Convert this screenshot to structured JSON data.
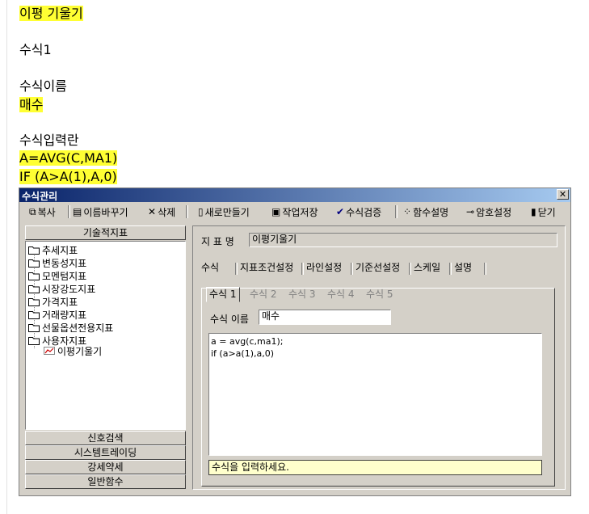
{
  "document": {
    "indicator_name": "이평 기울기",
    "formula_heading": "수식1",
    "formula_name_label": "수식이름",
    "formula_name_value": "매수",
    "formula_input_label": "수식입력란",
    "formula_lines": [
      "A=AVG(C,MA1)",
      "IF (A>A(1),A,0)"
    ]
  },
  "window": {
    "title": "수식관리",
    "close_glyph": "✕",
    "toolbar": {
      "copy": "복사",
      "rename": "이름바꾸기",
      "delete": "삭제",
      "new": "새로만들기",
      "save": "작업저장",
      "verify": "수식검증",
      "func_help": "함수설명",
      "password": "암호설정",
      "close": "닫기"
    },
    "left": {
      "header": "기술적지표",
      "tree": [
        "추세지표",
        "변동성지표",
        "모멘텀지표",
        "시장강도지표",
        "가격지표",
        "거래량지표",
        "선물옵션전용지표",
        "사용자지표"
      ],
      "tree_child": "이평기울기",
      "buttons": [
        "신호검색",
        "시스템트레이딩",
        "강세약세",
        "일반함수"
      ]
    },
    "right": {
      "indicator_label": "지 표 명",
      "indicator_value": "이평기울기",
      "tabs": [
        "수식",
        "지표조건설정",
        "라인설정",
        "기준선설정",
        "스케일",
        "설명"
      ],
      "formula_tabs": [
        "수식 1",
        "수식 2",
        "수식 3",
        "수식 4",
        "수식 5"
      ],
      "formula_name_label": "수식 이름",
      "formula_name_value": "매수",
      "editor_lines": [
        "a = avg(c,ma1);",
        "if (a>a(1),a,0)"
      ],
      "hint": "수식을 입력하세요."
    },
    "colors": {
      "highlight": "#ffff33",
      "title_bar": "#0a246a",
      "hint_background": "#ffffcc"
    }
  }
}
